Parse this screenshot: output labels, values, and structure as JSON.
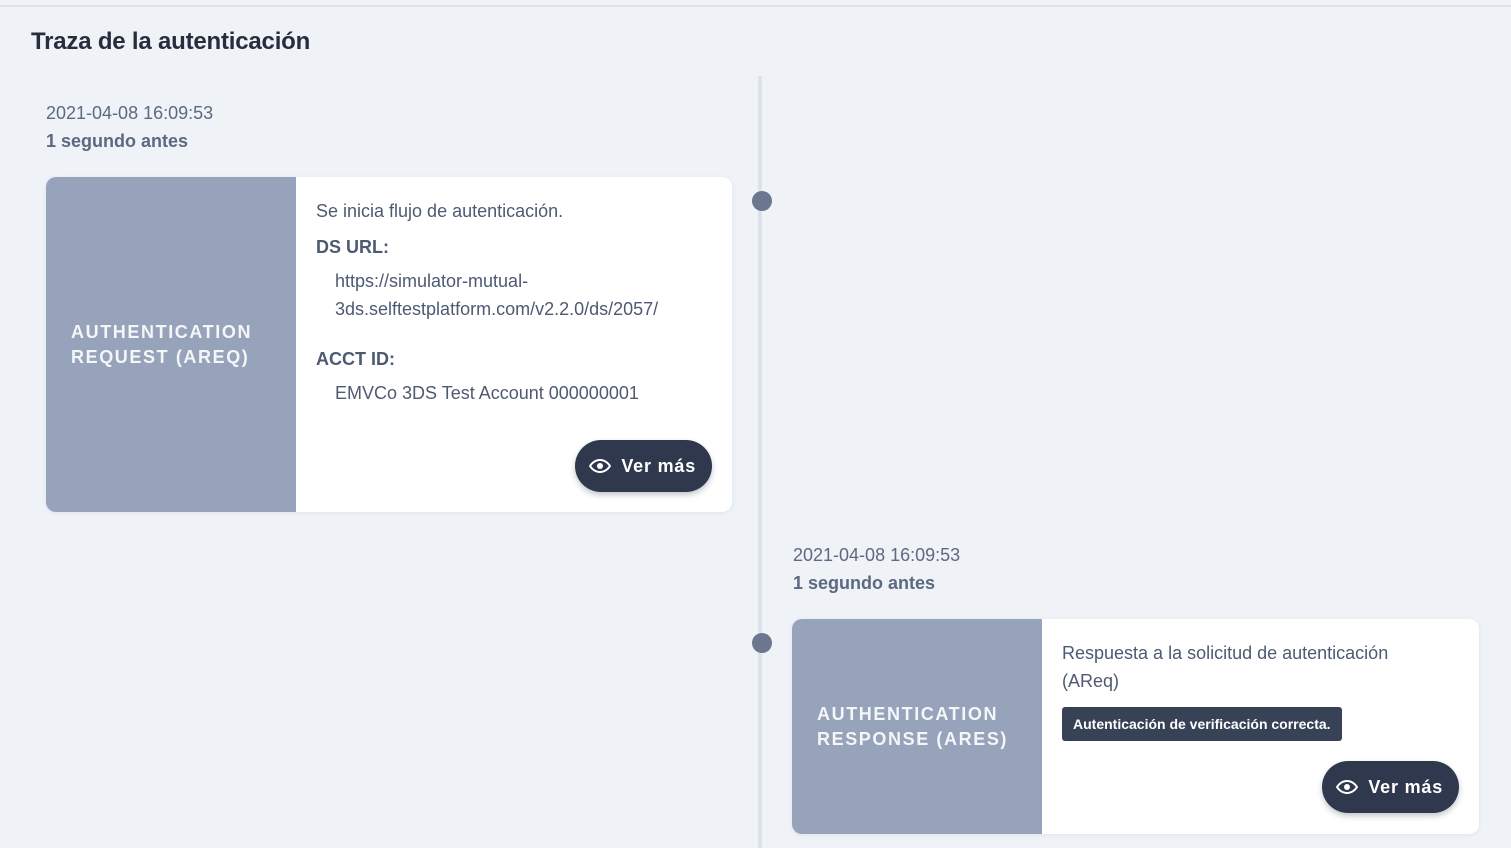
{
  "page": {
    "title": "Traza de la autenticación"
  },
  "events": [
    {
      "datetime": "2021-04-08 16:09:53",
      "relative": "1 segundo antes",
      "type": "AUTHENTICATION REQUEST (AREQ)",
      "type_line1": "AUTHENTICATION",
      "type_line2": "REQUEST (AREQ)",
      "description": "Se inicia flujo de autenticación.",
      "fields": [
        {
          "label": "DS URL:",
          "value_line1": "https://simulator-mutual-",
          "value_line2": "3ds.selftestplatform.com/v2.2.0/ds/2057/"
        },
        {
          "label": "ACCT ID:",
          "value": "EMVCo 3DS Test Account 000000001"
        }
      ],
      "button_label": "Ver más",
      "button_icon": "eye-icon"
    },
    {
      "datetime": "2021-04-08 16:09:53",
      "relative": "1 segundo antes",
      "type": "AUTHENTICATION RESPONSE (ARES)",
      "type_line1": "AUTHENTICATION",
      "type_line2": "RESPONSE (ARES)",
      "description_line1": "Respuesta a la solicitud de autenticación",
      "description_line2": "(AReq)",
      "status": "Autenticación de verificación correcta.",
      "button_label": "Ver más",
      "button_icon": "eye-icon"
    }
  ],
  "colors": {
    "background": "#eff3f8",
    "card_side": "#96a3ba",
    "button": "#2f384d",
    "timeline_dot": "#6b768f"
  }
}
